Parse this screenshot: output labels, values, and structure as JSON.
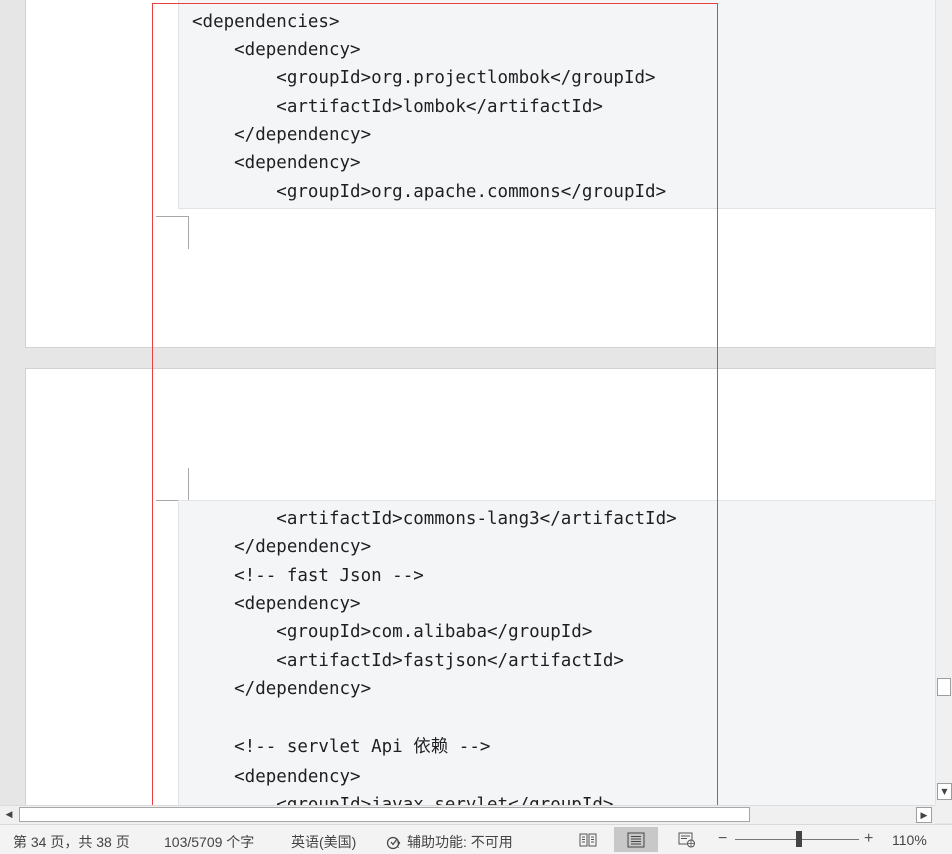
{
  "document": {
    "page1_code": [
      "<dependencies>",
      "    <dependency>",
      "        <groupId>org.projectlombok</groupId>",
      "        <artifactId>lombok</artifactId>",
      "    </dependency>",
      "    <dependency>",
      "        <groupId>org.apache.commons</groupId>"
    ],
    "page2_code": [
      "        <artifactId>commons-lang3</artifactId>",
      "    </dependency>",
      "    <!-- fast Json -->",
      "    <dependency>",
      "        <groupId>com.alibaba</groupId>",
      "        <artifactId>fastjson</artifactId>",
      "    </dependency>",
      "",
      "    <!-- servlet Api 依赖 -->",
      "    <dependency>",
      "        <groupId>javax.servlet</groupId>"
    ]
  },
  "statusbar": {
    "page_info": "第 34 页，共 38 页",
    "word_count": "103/5709 个字",
    "language": "英语(美国)",
    "accessibility": "辅助功能: 不可用",
    "zoom_minus": "−",
    "zoom_plus": "+",
    "zoom_level": "110%"
  },
  "icons": {
    "read_mode": "read-mode-icon",
    "print_layout": "print-layout-icon",
    "web_layout": "web-layout-icon",
    "accessibility": "accessibility-check-icon"
  },
  "colors": {
    "selection_frame": "#e8403c",
    "code_background": "#f4f5f7",
    "active_view": "#c8c8c8"
  }
}
